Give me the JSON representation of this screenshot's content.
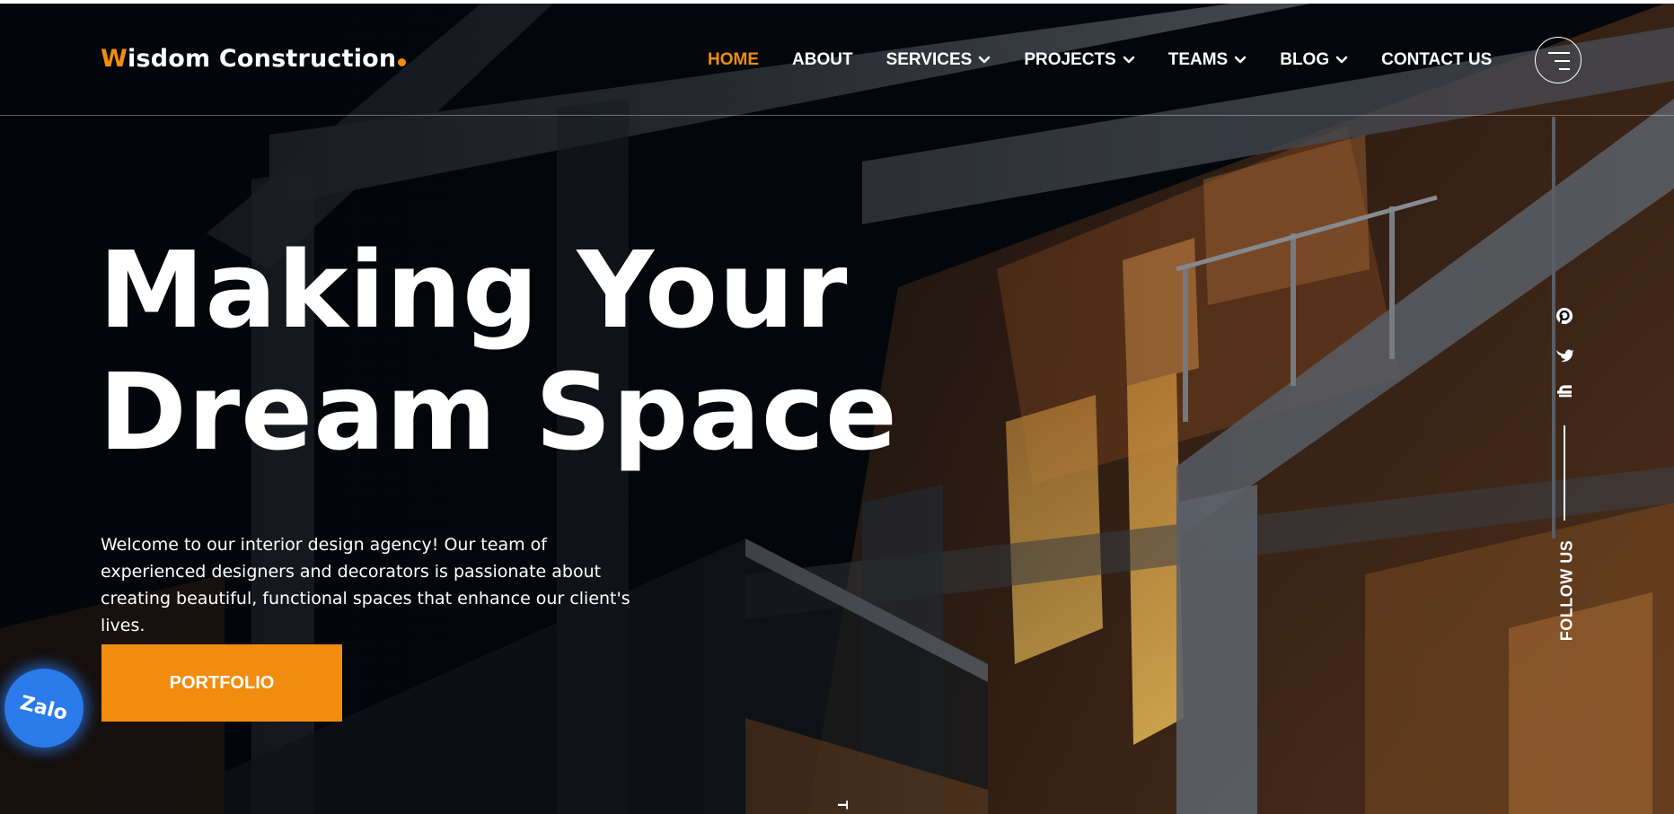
{
  "header": {
    "logo": {
      "first_letter": "W",
      "rest": "isdom Construction"
    },
    "nav": [
      {
        "label": "HOME",
        "active": true,
        "has_dropdown": false
      },
      {
        "label": "ABOUT",
        "active": false,
        "has_dropdown": false
      },
      {
        "label": "SERVICES",
        "active": false,
        "has_dropdown": true
      },
      {
        "label": "PROJECTS",
        "active": false,
        "has_dropdown": true
      },
      {
        "label": "TEAMS",
        "active": false,
        "has_dropdown": true
      },
      {
        "label": "BLOG",
        "active": false,
        "has_dropdown": true
      },
      {
        "label": "CONTACT US",
        "active": false,
        "has_dropdown": false
      }
    ],
    "menu_icon": "hamburger-menu-icon"
  },
  "hero": {
    "title_line1": "Making Your",
    "title_line2": "Dream Space",
    "description": "Welcome to our interior design agency! Our team of experienced designers and decorators is passionate about creating beautiful, functional spaces that enhance our client's lives.",
    "button_label": "PORTFOLIO"
  },
  "social": {
    "icons": [
      "pinterest-icon",
      "twitter-icon",
      "facebook-icon"
    ],
    "follow_label": "FOLLOW US"
  },
  "zalo": {
    "label": "Zalo"
  },
  "scroll": {
    "partial_label": "T"
  },
  "colors": {
    "accent": "#f28c0f",
    "background": "#03070b",
    "text": "#ffffff",
    "zalo": "#2b7bea"
  }
}
